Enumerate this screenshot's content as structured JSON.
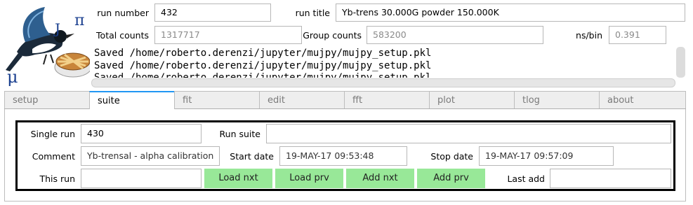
{
  "header": {
    "run_number_label": "run number",
    "run_number_value": "432",
    "run_title_label": "run title",
    "run_title_value": "Yb-trens 30.000G  powder   150.000K",
    "total_counts_label": "Total counts",
    "total_counts_value": "1317717",
    "group_counts_label": "Group counts",
    "group_counts_value": "583200",
    "ns_bin_label": "ns/bin",
    "ns_bin_value": "0.391"
  },
  "logo": {
    "pi": "π",
    "j": "J",
    "mu": "μ"
  },
  "console": {
    "lines": [
      "Saved /home/roberto.derenzi/jupyter/mujpy/mujpy_setup.pkl",
      "Saved /home/roberto.derenzi/jupyter/mujpy/mujpy_setup.pkl",
      "Saved /home/roberto.derenzi/jupyter/mujpy/mujpy_setup.pkl"
    ]
  },
  "tabs": [
    "setup",
    "suite",
    "fit",
    "edit",
    "fft",
    "plot",
    "tlog",
    "about"
  ],
  "active_tab": "suite",
  "suite": {
    "single_run_label": "Single run",
    "single_run_value": "430",
    "run_suite_label": "Run suite",
    "run_suite_value": "",
    "comment_label": "Comment",
    "comment_value": "Yb-trensal - alpha calibration",
    "start_date_label": "Start date",
    "start_date_value": "19-MAY-17 09:53:48",
    "stop_date_label": "Stop date",
    "stop_date_value": "19-MAY-17 09:57:09",
    "this_run_label": "This run",
    "this_run_value": "",
    "load_nxt_label": "Load nxt",
    "load_prv_label": "Load prv",
    "add_nxt_label": "Add nxt",
    "add_prv_label": "Add prv",
    "last_add_label": "Last add",
    "last_add_value": ""
  },
  "colors": {
    "button_green": "#98e898",
    "tab_accent": "#2196f3"
  }
}
